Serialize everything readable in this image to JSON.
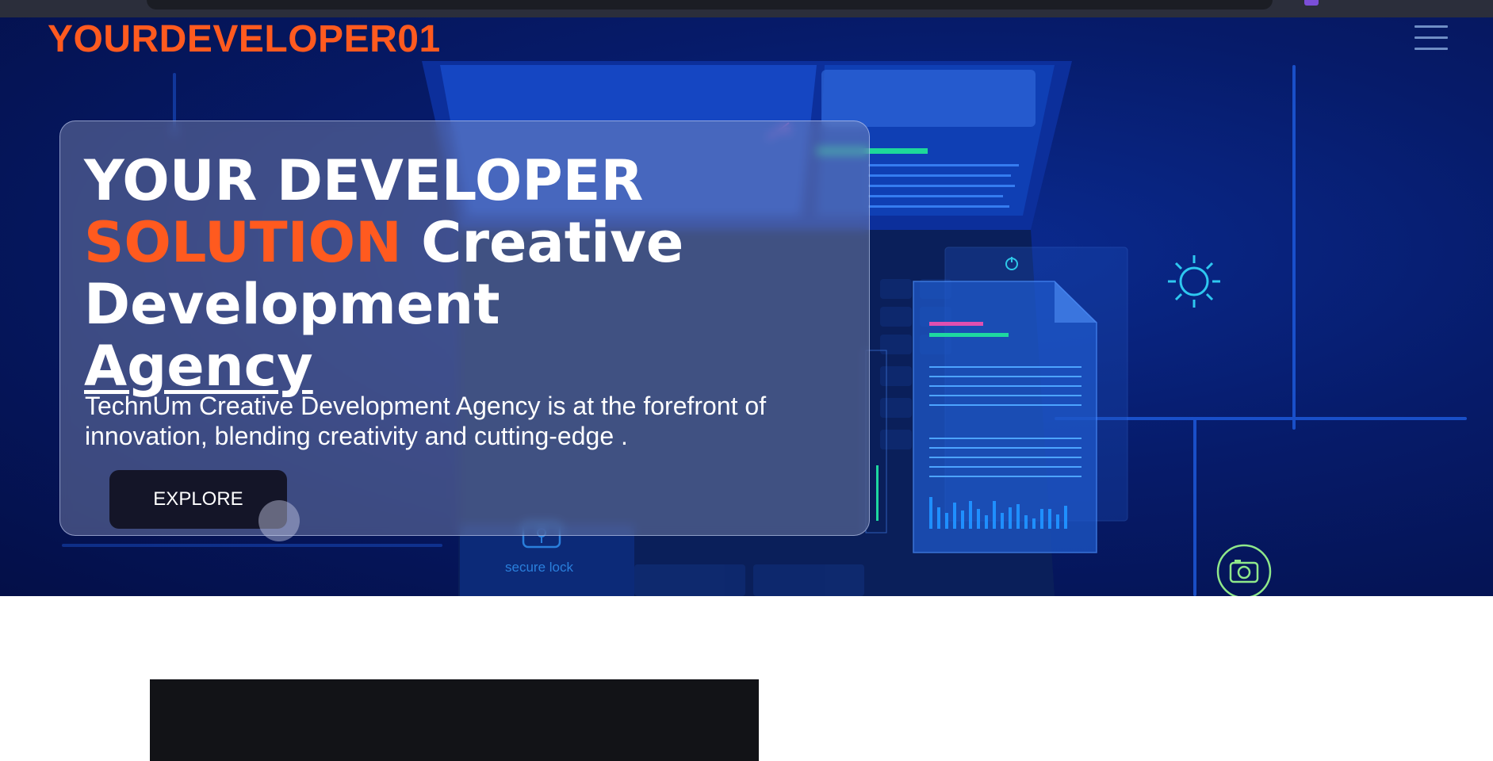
{
  "brand": {
    "name": "YOURDEVELOPER01"
  },
  "hero": {
    "headline": {
      "line1": "YOUR DEVELOPER",
      "accent": "SOLUTION",
      "rest": "Creative Development",
      "last": "Agency"
    },
    "description": "TechnUm Creative Development Agency is at the forefront of innovation, blending creativity and cutting-edge .",
    "cta_label": "EXPLORE",
    "illustration_label": "secure lock"
  },
  "icons": {
    "menu": "hamburger-menu-icon",
    "sun": "sun-icon",
    "camera": "camera-icon",
    "power": "power-icon",
    "lock": "lock-icon"
  },
  "colors": {
    "accent": "#ff5a1f",
    "hero_bg": "#061b6a",
    "button_bg": "#141528",
    "card_glass": "#8c96b9"
  }
}
